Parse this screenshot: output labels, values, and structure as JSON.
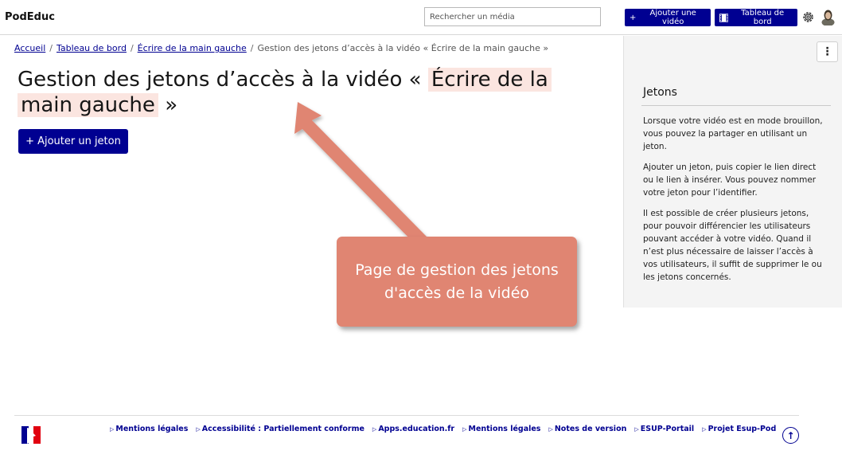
{
  "header": {
    "brand": "PodEduc",
    "search_placeholder": "Rechercher un média",
    "add_video_label": "Ajouter une vidéo",
    "dashboard_label": "Tableau de bord",
    "accent_color": "#000091"
  },
  "breadcrumb": {
    "items": [
      "Accueil",
      "Tableau de bord",
      "Écrire de la main gauche"
    ],
    "current": "Gestion des jetons d’accès à la vidéo « Écrire de la main gauche »",
    "separator": "/"
  },
  "main": {
    "title_prefix": "Gestion des jetons d’accès à la vidéo «",
    "title_highlight_1": "Écrire de la",
    "title_highlight_2": "main gauche",
    "title_suffix": "»",
    "add_token_label": "Ajouter un jeton"
  },
  "aside": {
    "title": "Jetons",
    "paragraphs": [
      "Lorsque votre vidéo est en mode brouillon, vous pouvez la partager en utilisant un jeton.",
      "Ajouter un jeton, puis copier le lien direct ou le lien à insérer. Vous pouvez nommer votre jeton pour l’identifier.",
      "Il est possible de créer plusieurs jetons, pour pouvoir différencier les utilisateurs pouvant accéder à votre vidéo. Quand il n’est plus nécessaire de laisser l’accès à vos utilisateurs, il suffit de supprimer le ou les jetons concernés."
    ]
  },
  "footer": {
    "links": [
      "Mentions légales",
      "Accessibilité : Partiellement conforme",
      "Apps.education.fr",
      "Mentions légales",
      "Notes de version",
      "ESUP-Portail",
      "Projet Esup-Pod"
    ]
  },
  "annotation": {
    "text": "Page de gestion des jetons d'accès de la vidéo",
    "color": "#e08572"
  }
}
